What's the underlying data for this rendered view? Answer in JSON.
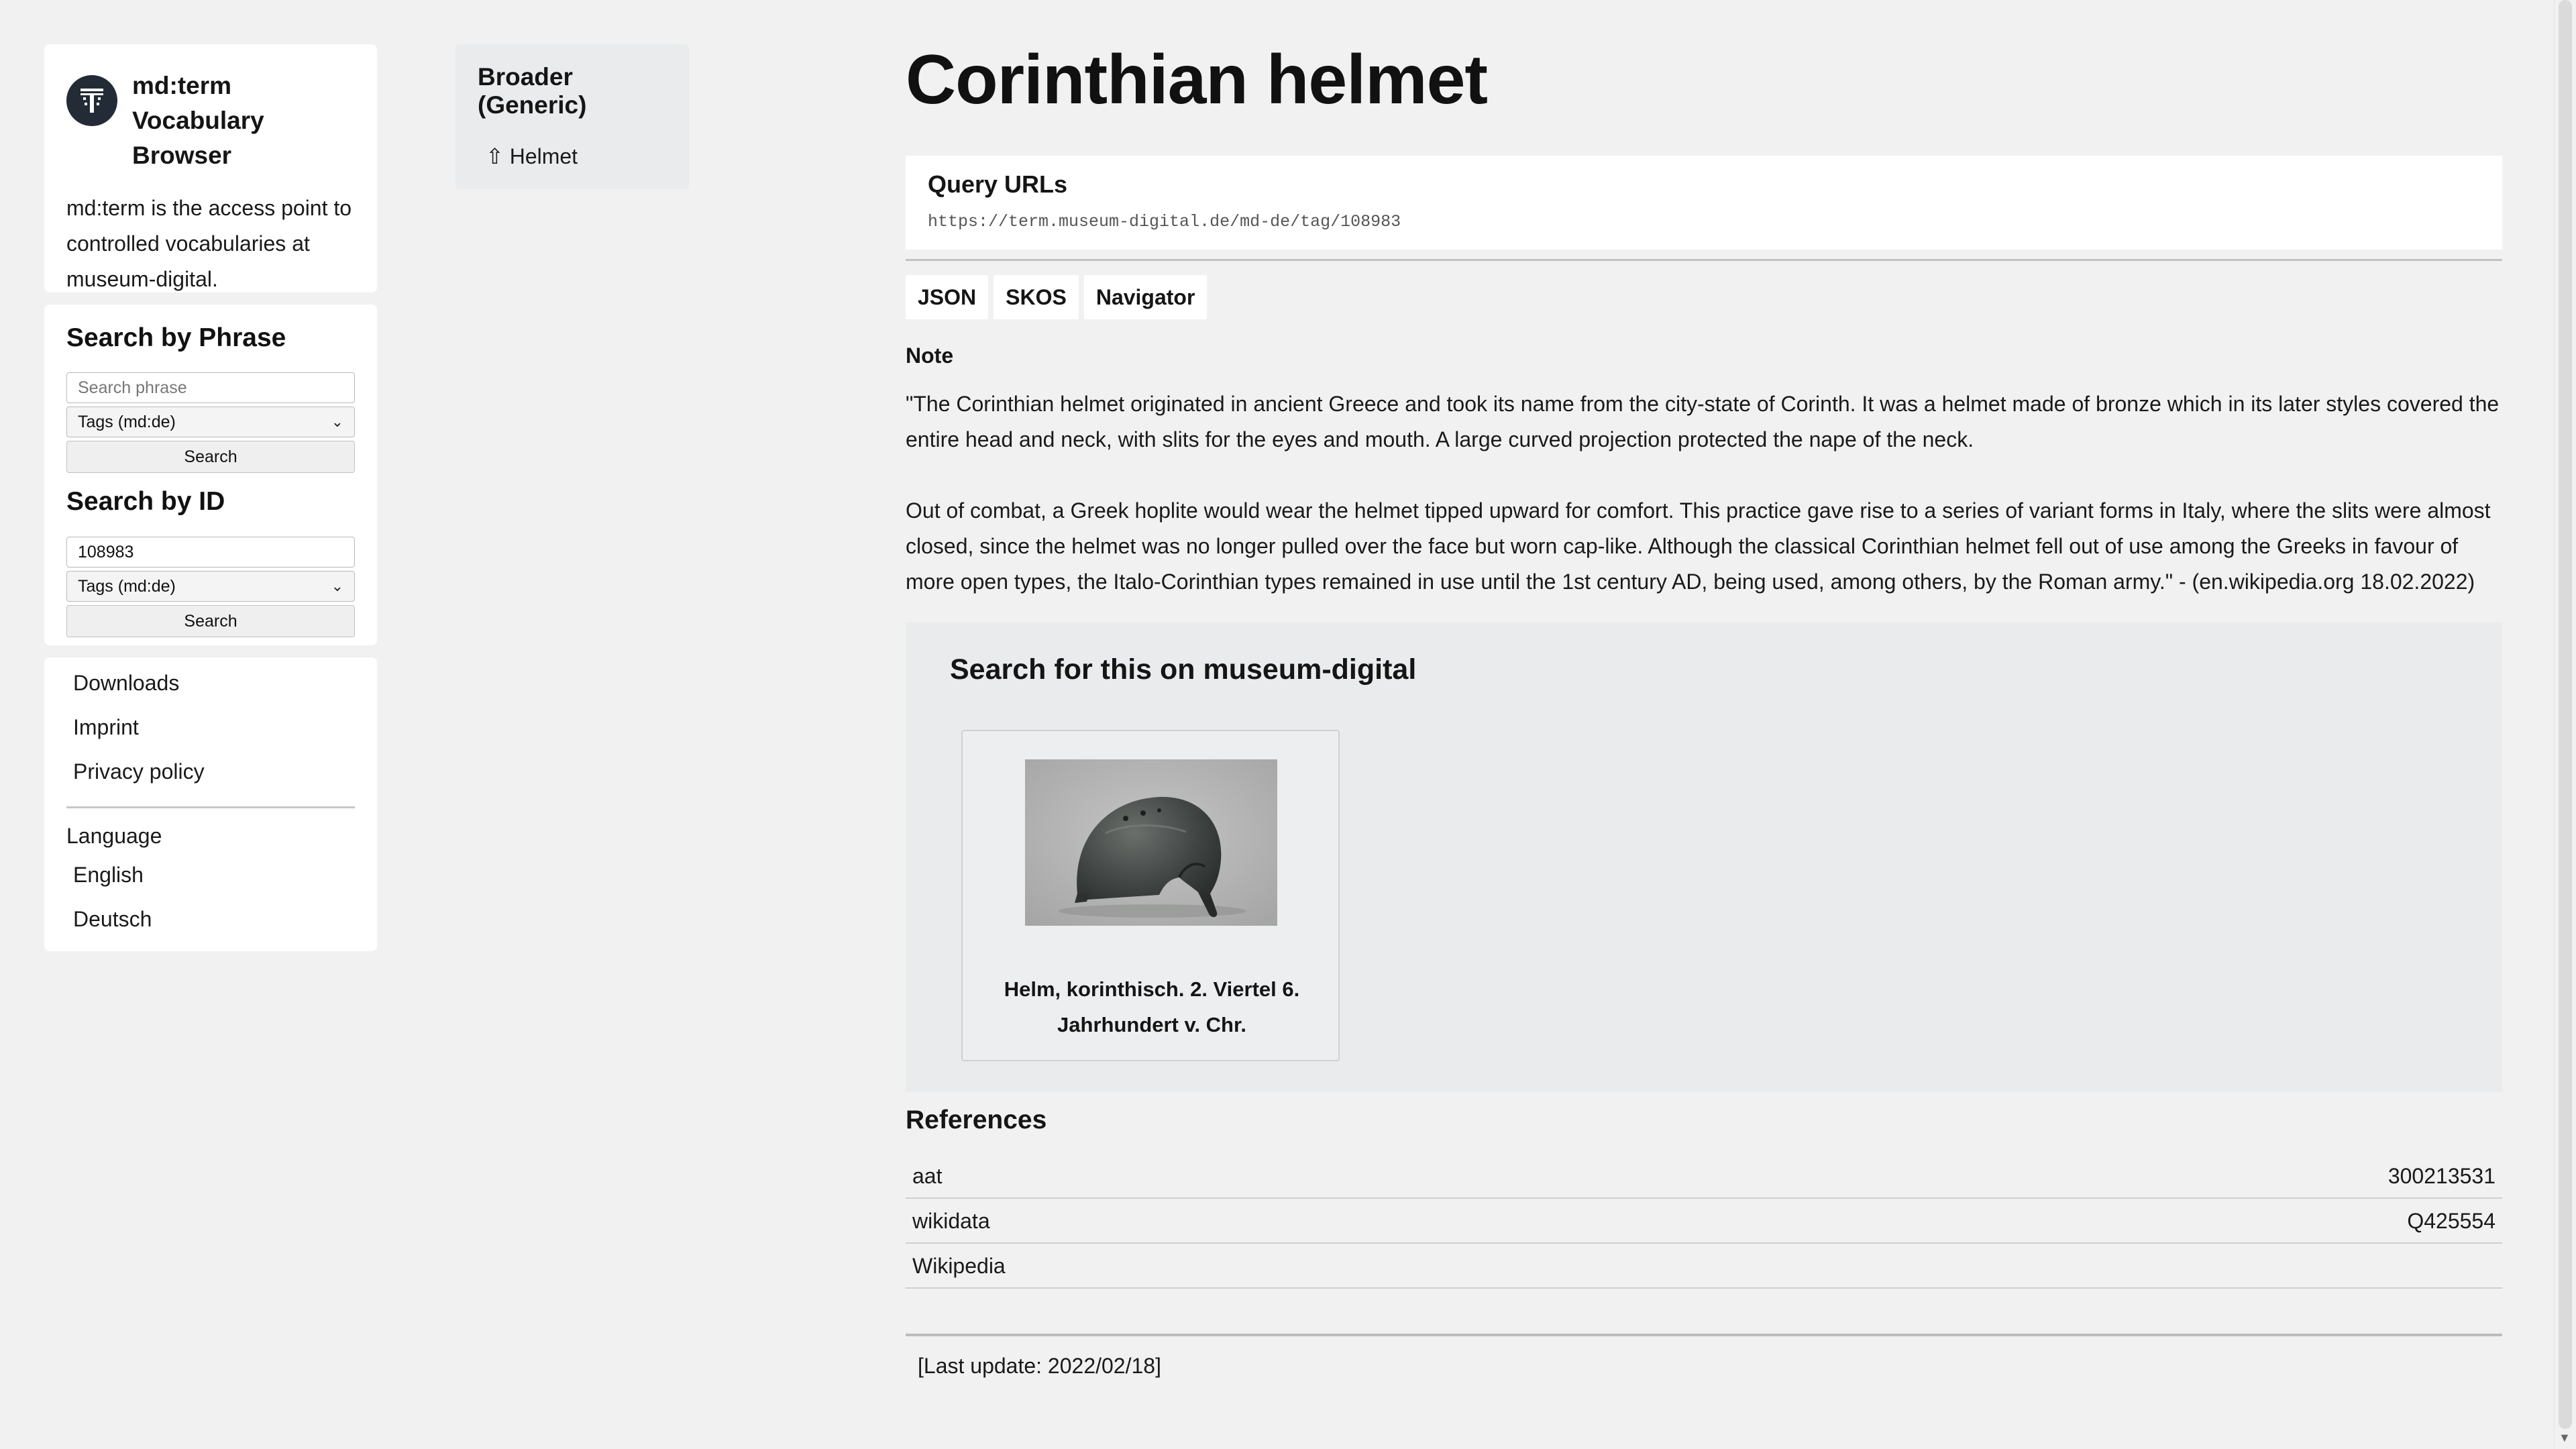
{
  "sidebar": {
    "brand_line1": "md:term",
    "brand_line2": "Vocabulary Browser",
    "brand_desc": "md:term is the access point to controlled vocabularies at museum-digital.",
    "search_phrase": {
      "heading": "Search by Phrase",
      "placeholder": "Search phrase",
      "vocab_selected": "Tags (md:de)",
      "button": "Search"
    },
    "search_id": {
      "heading": "Search by ID",
      "value": "108983",
      "vocab_selected": "Tags (md:de)",
      "button": "Search"
    },
    "links": [
      "Downloads",
      "Imprint",
      "Privacy policy"
    ],
    "language_label": "Language",
    "languages": [
      "English",
      "Deutsch"
    ]
  },
  "broader": {
    "heading": "Broader (Generic)",
    "item": "⇧ Helmet"
  },
  "main": {
    "title": "Corinthian helmet",
    "query_heading": "Query URLs",
    "query_url": "https://term.museum-digital.de/md-de/tag/108983",
    "tabs": [
      "JSON",
      "SKOS",
      "Navigator"
    ],
    "note_heading": "Note",
    "note_p1": "\"The Corinthian helmet originated in ancient Greece and took its name from the city-state of Corinth. It was a helmet made of bronze which in its later styles covered the entire head and neck, with slits for the eyes and mouth. A large curved projection protected the nape of the neck.",
    "note_p2": "Out of combat, a Greek hoplite would wear the helmet tipped upward for comfort. This practice gave rise to a series of variant forms in Italy, where the slits were almost closed, since the helmet was no longer pulled over the face but worn cap-like. Although the classical Corinthian helmet fell out of use among the Greeks in favour of more open types, the Italo-Corinthian types remained in use until the 1st century AD, being used, among others, by the Roman army.\" - (en.wikipedia.org 18.02.2022)",
    "search_panel_heading": "Search for this on museum-digital",
    "object_caption": "Helm, korinthisch. 2. Viertel 6. Jahrhundert v. Chr.",
    "references_heading": "References",
    "references": [
      {
        "source": "aat",
        "id": "300213531"
      },
      {
        "source": "wikidata",
        "id": "Q425554"
      },
      {
        "source": "Wikipedia",
        "id": ""
      }
    ],
    "last_update": "[Last update: 2022/02/18]"
  }
}
